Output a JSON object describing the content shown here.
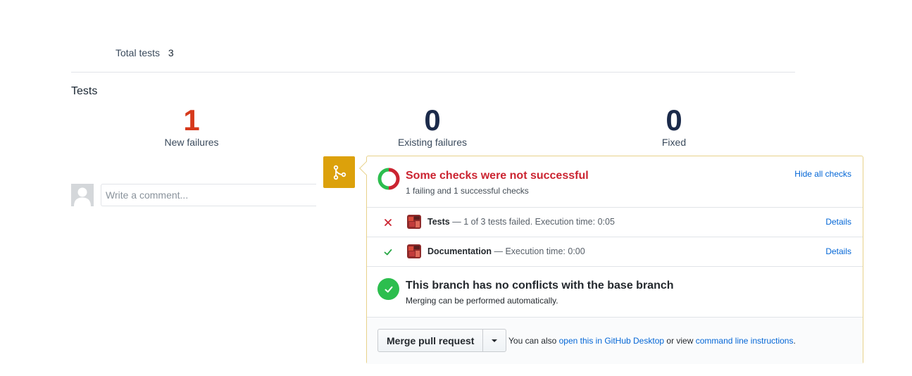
{
  "summary": {
    "label": "Total tests",
    "value": "3"
  },
  "section_title": "Tests",
  "stats": {
    "new_failures": {
      "value": "1",
      "label": "New failures"
    },
    "existing_failures": {
      "value": "0",
      "label": "Existing failures"
    },
    "fixed": {
      "value": "0",
      "label": "Fixed"
    }
  },
  "comment": {
    "placeholder": "Write a comment..."
  },
  "checks": {
    "title": "Some checks were not successful",
    "subtitle": "1 failing and 1 successful checks",
    "hide_label": "Hide all checks",
    "items": [
      {
        "name": "Tests",
        "description": "— 1 of 3 tests failed. Execution time: 0:05",
        "status": "failed",
        "details_label": "Details"
      },
      {
        "name": "Documentation",
        "description": "— Execution time: 0:00",
        "status": "success",
        "details_label": "Details"
      }
    ]
  },
  "conflicts": {
    "title": "This branch has no conflicts with the base branch",
    "subtitle": "Merging can be performed automatically."
  },
  "merge": {
    "button_label": "Merge pull request",
    "alt_prefix": "You can also",
    "desktop_link": "open this in GitHub Desktop",
    "alt_middle": "or view",
    "cli_link": "command line instructions",
    "alt_suffix": "."
  },
  "colors": {
    "failure_red": "#d6391b",
    "branch_badge": "#dca10b",
    "success_green": "#2cbe4e",
    "link_blue": "#0366d6"
  }
}
